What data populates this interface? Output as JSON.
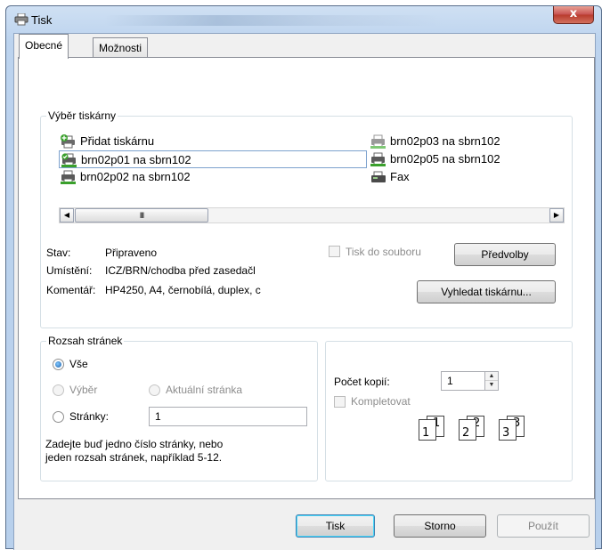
{
  "window": {
    "title": "Tisk",
    "close_glyph": "x"
  },
  "tabs": [
    {
      "label": "Obecné",
      "active": true
    },
    {
      "label": "Možnosti",
      "active": false
    }
  ],
  "printer_group": {
    "label": "Výběr tiskárny",
    "printers": [
      {
        "name": "Přidat tiskárnu",
        "icon": "add-printer-icon"
      },
      {
        "name": "brn02p01 na sbrn102",
        "icon": "default-printer-icon",
        "selected": true
      },
      {
        "name": "brn02p02 na sbrn102",
        "icon": "network-printer-icon"
      },
      {
        "name": "brn02p03 na sbrn102",
        "icon": "network-printer-icon"
      },
      {
        "name": "brn02p05 na sbrn102",
        "icon": "network-printer-icon"
      },
      {
        "name": "Fax",
        "icon": "fax-icon"
      }
    ],
    "scroll_thumb_glyph": "III",
    "status_label": "Stav:",
    "status_value": "Připraveno",
    "location_label": "Umístění:",
    "location_value": "ICZ/BRN/chodba před zasedačl",
    "comment_label": "Komentář:",
    "comment_value": "HP4250, A4, černobílá, duplex, c",
    "print_to_file_label": "Tisk do souboru",
    "preferences_label": "Předvolby",
    "find_printer_label": "Vyhledat tiskárnu..."
  },
  "range_group": {
    "label": "Rozsah stránek",
    "all_label": "Vše",
    "selection_label": "Výběr",
    "current_page_label": "Aktuální stránka",
    "pages_label": "Stránky:",
    "pages_value": "1",
    "hint_line1": "Zadejte buď jedno číslo stránky, nebo",
    "hint_line2": "jeden rozsah stránek, například 5-12."
  },
  "copies_group": {
    "copies_label": "Počet kopií:",
    "copies_value": "1",
    "collate_label": "Kompletovat",
    "page_numbers": [
      "1",
      "1",
      "2",
      "2",
      "3",
      "3"
    ]
  },
  "footer": {
    "print_label": "Tisk",
    "cancel_label": "Storno",
    "apply_label": "Použít"
  }
}
